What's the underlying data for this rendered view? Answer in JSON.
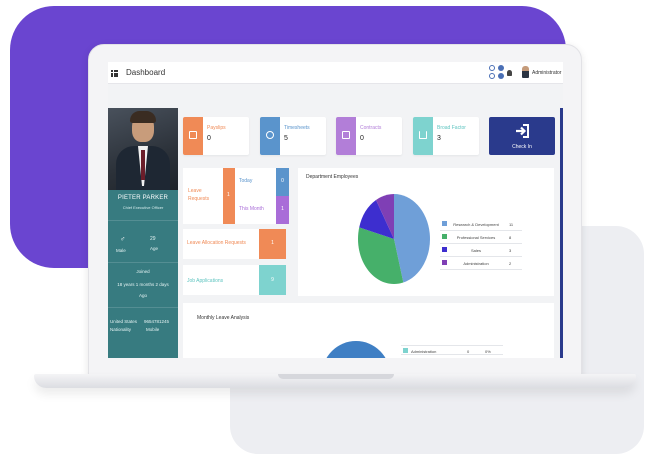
{
  "topbar": {
    "title": "Dashboard",
    "user_name": "Administrator"
  },
  "stats": [
    {
      "label": "Payslips",
      "value": "0",
      "color": "#F08A56",
      "icon": "payslip-icon"
    },
    {
      "label": "Timesheets",
      "value": "5",
      "color": "#5A94CC",
      "icon": "clock-icon"
    },
    {
      "label": "Contracts",
      "value": "0",
      "color": "#B27ED8",
      "icon": "contract-icon"
    },
    {
      "label": "Broad Factor",
      "value": "3",
      "color": "#7ED3CF",
      "icon": "chart-icon"
    }
  ],
  "checkin": {
    "label": "Check In",
    "color": "#2A3A8C",
    "icon": "sign-in-icon"
  },
  "profile": {
    "name": "PIETER PARKER",
    "role": "Chief Executive Officer",
    "gender": "Male",
    "age_value": "29",
    "age_label": "Age",
    "joined_label": "Joined",
    "joined_value": "18 years 1 months 2 days",
    "joined_ago": "Ago",
    "nationality_value": "United States",
    "nationality_label": "Nationality",
    "phone_value": "9654781245",
    "phone_label": "Mobile"
  },
  "leave": {
    "title": "Leave Requests",
    "count": "1",
    "today_label": "Today",
    "today_value": "0",
    "month_label": "This Month",
    "month_value": "1"
  },
  "leave_allocation": {
    "label": "Leave Allocation Requests",
    "value": "1"
  },
  "job_applications": {
    "label": "Job Applications",
    "value": "9"
  },
  "department_employees": {
    "title": "Department Employees",
    "legend": [
      {
        "name": "Research & Development",
        "count": "11",
        "color": "#6F9FD8"
      },
      {
        "name": "Professional Services",
        "count": "8",
        "color": "#46B06A"
      },
      {
        "name": "Sales",
        "count": "3",
        "color": "#3D2ECF"
      },
      {
        "name": "Administration",
        "count": "2",
        "color": "#7F3FB5"
      }
    ]
  },
  "monthly_leave": {
    "title": "Monthly Leave Analysis",
    "rows": [
      {
        "name": "Administration",
        "count": "0",
        "percent": "0%",
        "color": "#7ED3CF"
      }
    ]
  }
}
